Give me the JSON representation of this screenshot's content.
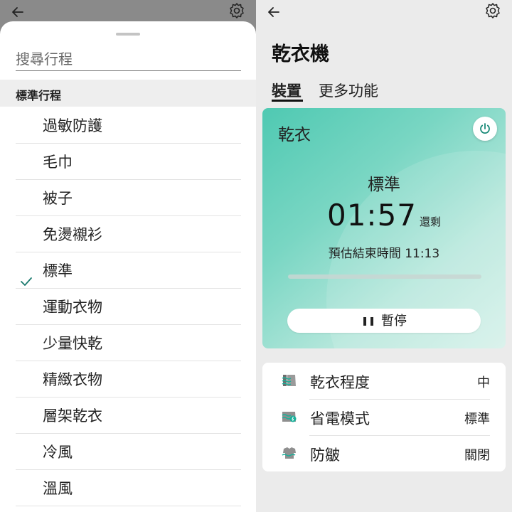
{
  "left": {
    "back_icon": "arrow-left-icon",
    "settings_icon": "gear-icon",
    "search_placeholder": "搜尋行程",
    "section_title": "標準行程",
    "programs": [
      {
        "label": "過敏防護",
        "selected": false
      },
      {
        "label": "毛巾",
        "selected": false
      },
      {
        "label": "被子",
        "selected": false
      },
      {
        "label": "免燙襯衫",
        "selected": false
      },
      {
        "label": "標準",
        "selected": true
      },
      {
        "label": "運動衣物",
        "selected": false
      },
      {
        "label": "少量快乾",
        "selected": false
      },
      {
        "label": "精緻衣物",
        "selected": false
      },
      {
        "label": "層架乾衣",
        "selected": false
      },
      {
        "label": "冷風",
        "selected": false
      },
      {
        "label": "溫風",
        "selected": false
      }
    ]
  },
  "right": {
    "title": "乾衣機",
    "tabs": [
      {
        "label": "裝置",
        "active": true
      },
      {
        "label": "更多功能",
        "active": false
      }
    ],
    "status_card": {
      "mode": "乾衣",
      "cycle": "標準",
      "time_remaining": "01:57",
      "time_remaining_label": "還剩",
      "eta": "預估結束時間 11:13",
      "progress": 0,
      "pause_label": "暫停",
      "accent_color": "#1a8a78",
      "gradient_start": "#4fc9b2",
      "gradient_end": "#d6f1ea"
    },
    "settings": [
      {
        "icon": "dryness-level-icon",
        "label": "乾衣程度",
        "value": "中"
      },
      {
        "icon": "energy-saving-icon",
        "label": "省電模式",
        "value": "標準"
      },
      {
        "icon": "wrinkle-prevention-icon",
        "label": "防皺",
        "value": "關閉"
      }
    ]
  }
}
